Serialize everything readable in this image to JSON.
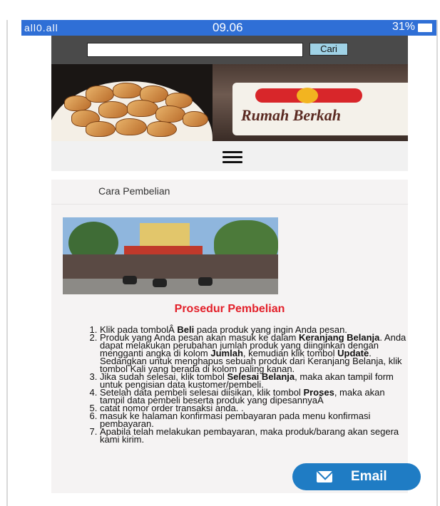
{
  "status_bar": {
    "signal": "all0.all",
    "time": "09.06",
    "battery": "31%"
  },
  "search": {
    "placeholder": "",
    "button_label": "Cari"
  },
  "banner": {
    "store_name": "Rumah Berkah"
  },
  "menu": {
    "icon": "hamburger-menu-icon"
  },
  "content": {
    "page_title": "Cara Pembelian",
    "section_title": "Prosedur Pembelian",
    "steps": [
      {
        "pre": "Klik pada tombolÂ ",
        "bold": "Beli",
        "post": " pada produk yang ingin Anda pesan."
      },
      {
        "pre": "Produk yang Anda pesan akan masuk ke dalam ",
        "bold": "Keranjang Belanja",
        "post": ". Anda dapat melakukan perubahan jumlah produk yang diinginkan dengan mengganti angka di kolom ",
        "bold2": "Jumlah",
        "post2": ", kemudian klik tombol ",
        "bold3": "Update",
        "post3": ". Sedangkan untuk menghapus sebuah produk dari Keranjang Belanja, klik tombol Kali yang berada di kolom paling kanan."
      },
      {
        "pre": "Jika sudah selesai, klik tombol ",
        "bold": "Selesai Belanja",
        "post": ", maka akan tampil form untuk pengisian data kustomer/pembeli."
      },
      {
        "pre": "Setelah data pembeli selesai diisikan, klik tombol ",
        "bold": "Proses",
        "post": ", maka akan tampil data pembeli beserta produk yang dipesannyaÂ"
      },
      {
        "pre": "catat nomor order transaksi anda. .",
        "bold": "",
        "post": ""
      },
      {
        "pre": "masuk ke halaman konfirmasi pembayaran pada menu konfirmasi pembayaran.",
        "bold": "",
        "post": ""
      },
      {
        "pre": "Apabila telah melakukan pembayaran, maka produk/barang akan segera kami kirim.",
        "bold": "",
        "post": ""
      }
    ]
  },
  "email_button": {
    "label": "Email",
    "icon": "envelope-icon"
  },
  "colors": {
    "status_bar": "#2f6fd6",
    "header": "#4a4a4a",
    "section_title": "#e3202a",
    "email_button": "#1f7cc4"
  }
}
